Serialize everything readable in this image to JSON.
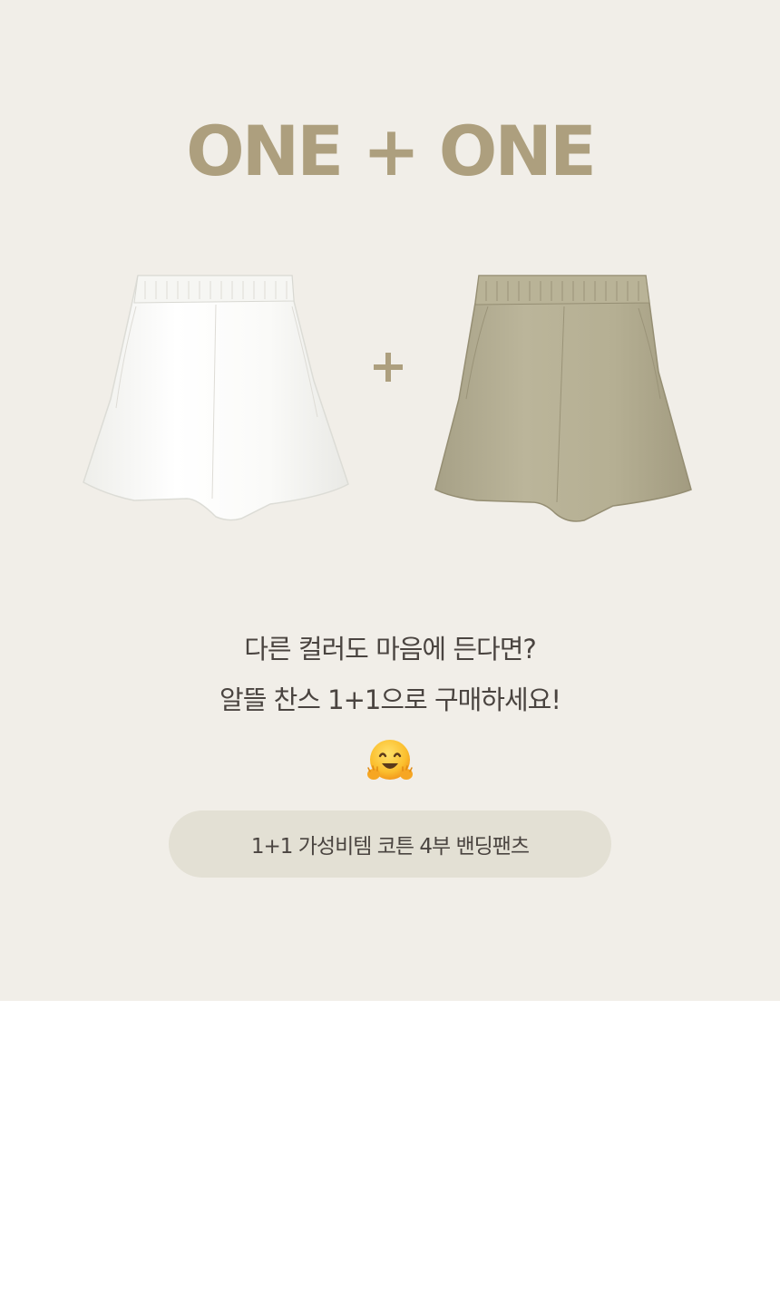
{
  "banner": {
    "headline": "ONE + ONE",
    "products": [
      {
        "icon": "white-shorts-image",
        "color": "#fbfbf9"
      },
      {
        "icon": "beige-shorts-image",
        "color": "#b6b094"
      }
    ],
    "plus_icon": "plus-icon",
    "copy_line_1": "다른 컬러도 마음에 든다면?",
    "copy_line_2": "알뜰 찬스 1+1으로 구매하세요!",
    "emoji": "hugging-face-emoji",
    "pill_label": "1+1 가성비템 코튼 4부 밴딩팬츠"
  },
  "colors": {
    "background": "#f1eee8",
    "accent": "#ad9f7e",
    "pill": "#e3e0d4",
    "text": "#4a4440"
  }
}
